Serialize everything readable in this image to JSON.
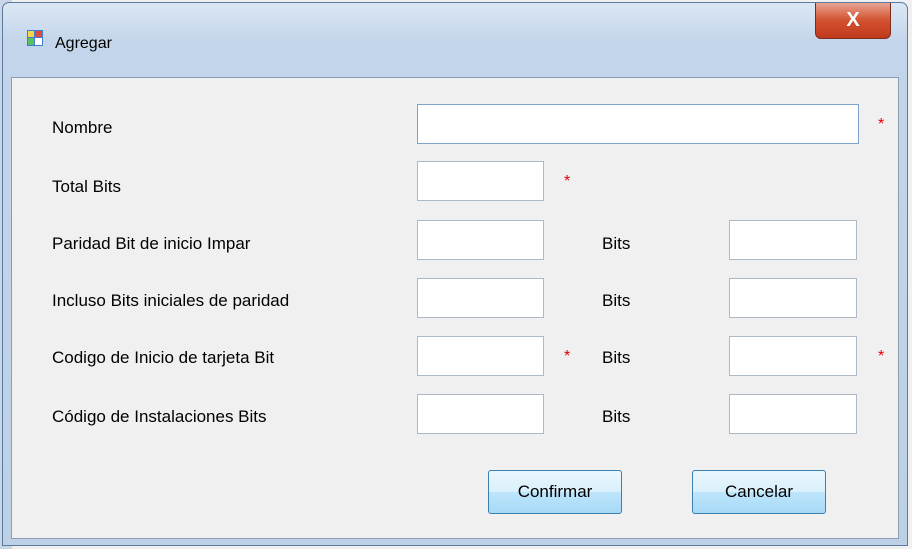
{
  "window": {
    "title": "Agregar",
    "close_label": "X"
  },
  "form": {
    "rows": [
      {
        "label": "Nombre",
        "value": "",
        "required": "*"
      },
      {
        "label": "Total Bits",
        "value": "",
        "required": "*"
      },
      {
        "label": "Paridad Bit de inicio Impar",
        "value": "",
        "bits_label": "Bits",
        "bits_value": ""
      },
      {
        "label": "Incluso Bits iniciales de paridad",
        "value": "",
        "bits_label": "Bits",
        "bits_value": ""
      },
      {
        "label": "Codigo de Inicio de tarjeta Bit",
        "value": "",
        "required": "*",
        "bits_label": "Bits",
        "bits_value": "",
        "bits_required": "*"
      },
      {
        "label": "Código de Instalaciones Bits",
        "value": "",
        "bits_label": "Bits",
        "bits_value": ""
      }
    ]
  },
  "buttons": {
    "confirm_label": "Confirmar",
    "cancel_label": "Cancelar"
  },
  "colors": {
    "required": "#e00000",
    "button_border": "#3c7fb1"
  },
  "icons": {
    "app": "form-app-icon",
    "close": "close-icon"
  }
}
